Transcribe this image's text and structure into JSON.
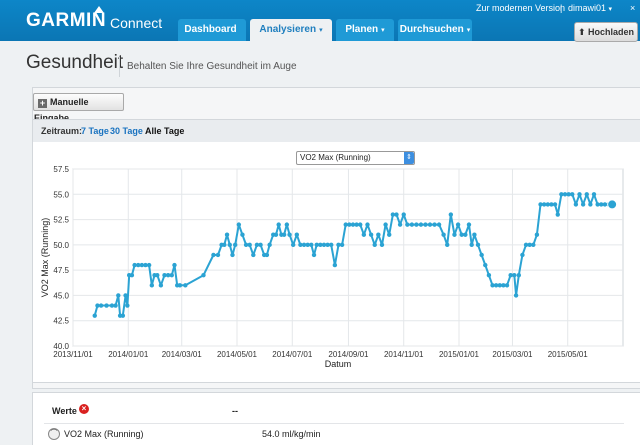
{
  "header": {
    "logo": "GARMIN",
    "logo_sub": "Connect",
    "modern_link": "Zur modernen Version",
    "separator": "|",
    "user": "dimawi01",
    "user_caret": "▾",
    "close": "×",
    "tabs": [
      {
        "label": "Dashboard",
        "caret": ""
      },
      {
        "label": "Analysieren",
        "caret": "▾"
      },
      {
        "label": "Planen",
        "caret": "▾"
      },
      {
        "label": "Durchsuchen",
        "caret": "▾"
      }
    ],
    "upload_label": "⬆ Hochladen"
  },
  "page": {
    "title": "Gesundheit",
    "subtitle": "Behalten Sie Ihre Gesundheit im Auge"
  },
  "toolbar": {
    "manual_plus": "+",
    "manual_label": "Manuelle Eingabe"
  },
  "range": {
    "label": "Zeitraum:",
    "options": [
      "7 Tage",
      "30 Tage",
      "Alle Tage"
    ],
    "selected": "Alle Tage"
  },
  "metric_select": {
    "value": "VO2 Max (Running)",
    "arrow": "⇕"
  },
  "stats": {
    "header": "Werte",
    "header_icon": "×",
    "header_value": "--",
    "row_icon": "⌒",
    "row_name": "VO2 Max (Running)",
    "row_value": "54.0 ml/kg/min"
  },
  "chart_data": {
    "type": "line",
    "ylabel": "VO2 Max (Running)",
    "xlabel": "Datum",
    "ylim": [
      40.0,
      57.5
    ],
    "yticks": [
      "40.0",
      "42.5",
      "45.0",
      "47.5",
      "50.0",
      "52.5",
      "55.0",
      "57.5"
    ],
    "xlim": [
      "2013-11-01",
      "2015-07-01"
    ],
    "xticks": [
      "2013/11/01",
      "2014/01/01",
      "2014/03/01",
      "2014/05/01",
      "2014/07/01",
      "2014/09/01",
      "2014/11/01",
      "2015/01/01",
      "2015/03/01",
      "2015/05/01"
    ],
    "grid": true,
    "color": "#2ba3d3",
    "series": [
      {
        "points": [
          [
            "2013-11-25",
            43
          ],
          [
            "2013-11-28",
            44
          ],
          [
            "2013-12-02",
            44
          ],
          [
            "2013-12-08",
            44
          ],
          [
            "2013-12-14",
            44
          ],
          [
            "2013-12-18",
            44
          ],
          [
            "2013-12-21",
            45
          ],
          [
            "2013-12-23",
            43
          ],
          [
            "2013-12-26",
            43
          ],
          [
            "2013-12-29",
            45
          ],
          [
            "2013-12-31",
            44
          ],
          [
            "2014-01-02",
            47
          ],
          [
            "2014-01-05",
            47
          ],
          [
            "2014-01-08",
            48
          ],
          [
            "2014-01-12",
            48
          ],
          [
            "2014-01-16",
            48
          ],
          [
            "2014-01-20",
            48
          ],
          [
            "2014-01-24",
            48
          ],
          [
            "2014-01-27",
            46
          ],
          [
            "2014-01-30",
            47
          ],
          [
            "2014-02-02",
            47
          ],
          [
            "2014-02-06",
            46
          ],
          [
            "2014-02-10",
            47
          ],
          [
            "2014-02-14",
            47
          ],
          [
            "2014-02-18",
            47
          ],
          [
            "2014-02-21",
            48
          ],
          [
            "2014-02-24",
            46
          ],
          [
            "2014-02-27",
            46
          ],
          [
            "2014-03-05",
            46
          ],
          [
            "2014-03-25",
            47
          ],
          [
            "2014-04-05",
            49
          ],
          [
            "2014-04-10",
            49
          ],
          [
            "2014-04-14",
            50
          ],
          [
            "2014-04-17",
            50
          ],
          [
            "2014-04-20",
            51
          ],
          [
            "2014-04-23",
            50
          ],
          [
            "2014-04-26",
            49
          ],
          [
            "2014-04-29",
            50
          ],
          [
            "2014-05-03",
            52
          ],
          [
            "2014-05-07",
            51
          ],
          [
            "2014-05-11",
            50
          ],
          [
            "2014-05-15",
            50
          ],
          [
            "2014-05-19",
            49
          ],
          [
            "2014-05-23",
            50
          ],
          [
            "2014-05-27",
            50
          ],
          [
            "2014-05-31",
            49
          ],
          [
            "2014-06-03",
            49
          ],
          [
            "2014-06-06",
            50
          ],
          [
            "2014-06-10",
            51
          ],
          [
            "2014-06-13",
            51
          ],
          [
            "2014-06-16",
            52
          ],
          [
            "2014-06-19",
            51
          ],
          [
            "2014-06-22",
            51
          ],
          [
            "2014-06-25",
            52
          ],
          [
            "2014-06-28",
            51
          ],
          [
            "2014-07-02",
            50
          ],
          [
            "2014-07-06",
            51
          ],
          [
            "2014-07-10",
            50
          ],
          [
            "2014-07-14",
            50
          ],
          [
            "2014-07-18",
            50
          ],
          [
            "2014-07-22",
            50
          ],
          [
            "2014-07-25",
            49
          ],
          [
            "2014-07-28",
            50
          ],
          [
            "2014-08-01",
            50
          ],
          [
            "2014-08-05",
            50
          ],
          [
            "2014-08-09",
            50
          ],
          [
            "2014-08-13",
            50
          ],
          [
            "2014-08-17",
            48
          ],
          [
            "2014-08-21",
            50
          ],
          [
            "2014-08-25",
            50
          ],
          [
            "2014-08-29",
            52
          ],
          [
            "2014-09-02",
            52
          ],
          [
            "2014-09-06",
            52
          ],
          [
            "2014-09-10",
            52
          ],
          [
            "2014-09-14",
            52
          ],
          [
            "2014-09-18",
            51
          ],
          [
            "2014-09-22",
            52
          ],
          [
            "2014-09-26",
            51
          ],
          [
            "2014-09-30",
            50
          ],
          [
            "2014-10-04",
            51
          ],
          [
            "2014-10-08",
            50
          ],
          [
            "2014-10-12",
            52
          ],
          [
            "2014-10-16",
            51
          ],
          [
            "2014-10-20",
            53
          ],
          [
            "2014-10-24",
            53
          ],
          [
            "2014-10-28",
            52
          ],
          [
            "2014-11-01",
            53
          ],
          [
            "2014-11-05",
            52
          ],
          [
            "2014-11-10",
            52
          ],
          [
            "2014-11-15",
            52
          ],
          [
            "2014-11-20",
            52
          ],
          [
            "2014-11-25",
            52
          ],
          [
            "2014-11-30",
            52
          ],
          [
            "2014-12-05",
            52
          ],
          [
            "2014-12-10",
            52
          ],
          [
            "2014-12-15",
            51
          ],
          [
            "2014-12-19",
            50
          ],
          [
            "2014-12-23",
            53
          ],
          [
            "2014-12-27",
            51
          ],
          [
            "2014-12-31",
            52
          ],
          [
            "2015-01-04",
            51
          ],
          [
            "2015-01-08",
            51
          ],
          [
            "2015-01-12",
            52
          ],
          [
            "2015-01-15",
            50
          ],
          [
            "2015-01-18",
            51
          ],
          [
            "2015-01-22",
            50
          ],
          [
            "2015-01-26",
            49
          ],
          [
            "2015-01-30",
            48
          ],
          [
            "2015-02-03",
            47
          ],
          [
            "2015-02-07",
            46
          ],
          [
            "2015-02-11",
            46
          ],
          [
            "2015-02-15",
            46
          ],
          [
            "2015-02-19",
            46
          ],
          [
            "2015-02-23",
            46
          ],
          [
            "2015-02-27",
            47
          ],
          [
            "2015-03-03",
            47
          ],
          [
            "2015-03-05",
            45
          ],
          [
            "2015-03-08",
            47
          ],
          [
            "2015-03-12",
            49
          ],
          [
            "2015-03-16",
            50
          ],
          [
            "2015-03-20",
            50
          ],
          [
            "2015-03-24",
            50
          ],
          [
            "2015-03-28",
            51
          ],
          [
            "2015-04-01",
            54
          ],
          [
            "2015-04-05",
            54
          ],
          [
            "2015-04-09",
            54
          ],
          [
            "2015-04-13",
            54
          ],
          [
            "2015-04-17",
            54
          ],
          [
            "2015-04-20",
            53
          ],
          [
            "2015-04-24",
            55
          ],
          [
            "2015-04-28",
            55
          ],
          [
            "2015-05-02",
            55
          ],
          [
            "2015-05-06",
            55
          ],
          [
            "2015-05-10",
            54
          ],
          [
            "2015-05-14",
            55
          ],
          [
            "2015-05-18",
            54
          ],
          [
            "2015-05-22",
            55
          ],
          [
            "2015-05-26",
            54
          ],
          [
            "2015-05-30",
            55
          ],
          [
            "2015-06-03",
            54
          ],
          [
            "2015-06-07",
            54
          ],
          [
            "2015-06-11",
            54
          ],
          [
            "2015-06-15",
            54
          ],
          [
            "2015-06-19",
            54
          ]
        ]
      }
    ]
  }
}
